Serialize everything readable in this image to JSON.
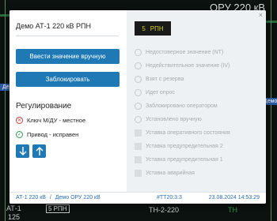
{
  "background": {
    "title": "ОРУ 220 кВ",
    "tag_left": "Демо",
    "tag_right": "Демо",
    "label_at": "АТ-1",
    "label_125": "125",
    "rpn": "5 РПН",
    "label_tn": "ТН-2-220",
    "label_tn2": "ТН"
  },
  "dialog": {
    "title": "Демо АТ-1 220 кВ РПН",
    "close_icon": "×",
    "btn_manual": "Ввести значение вручную",
    "btn_block": "Заблокировать",
    "regulation_title": "Регулирование",
    "status": [
      {
        "text": "Ключ М/ДУ - местное",
        "state": "bad"
      },
      {
        "text": "Привод - исправен",
        "state": "ok"
      }
    ],
    "rpn_value": "5",
    "rpn_label": "РПН",
    "flags": [
      "Недостоверное значение (NT)",
      "Недействительное значение (IV)",
      "Взят с резерва",
      "Идет опрос",
      "Заблокировано оператором",
      "Установлено вручную",
      "Уставка оперативного состояния",
      "Уставка предупредительная 2",
      "Уставка предупредительная 1",
      "Уставка аварийная"
    ],
    "footer": {
      "path_a": "АТ-1 220 кВ",
      "separator": "/",
      "path_b": "Демо ОРУ 220 кВ",
      "tag": "#TT20:3:3",
      "timestamp": "23.08.2024 14:53:29"
    }
  },
  "colors": {
    "accent": "#1f79b5",
    "rpn_text": "#d6d21e",
    "bad": "#d23a3a",
    "ok": "#2e9a4a"
  }
}
